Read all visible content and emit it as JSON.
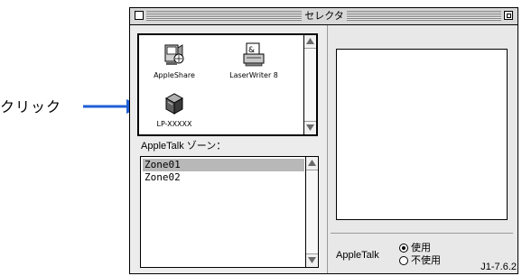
{
  "annotation": {
    "label": "クリック"
  },
  "window": {
    "title": "セレクタ",
    "devices": [
      {
        "label": "AppleShare",
        "icon": "appleshare-icon"
      },
      {
        "label": "LaserWriter 8",
        "icon": "laserwriter-icon"
      },
      {
        "label": "LP-XXXXX",
        "icon": "printer-icon"
      }
    ],
    "zone_label": "AppleTalk ゾーン：",
    "zones": [
      "Zone01",
      "Zone02"
    ],
    "selected_zone": "Zone01",
    "appletalk": {
      "label": "AppleTalk",
      "options": [
        "使用",
        "不使用"
      ],
      "selected": "使用"
    },
    "version": "J1-7.6.2"
  },
  "colors": {
    "window_bg": "#e8e8e8",
    "selection": "#b8b8b8",
    "arrow": "#1f5fd6"
  }
}
